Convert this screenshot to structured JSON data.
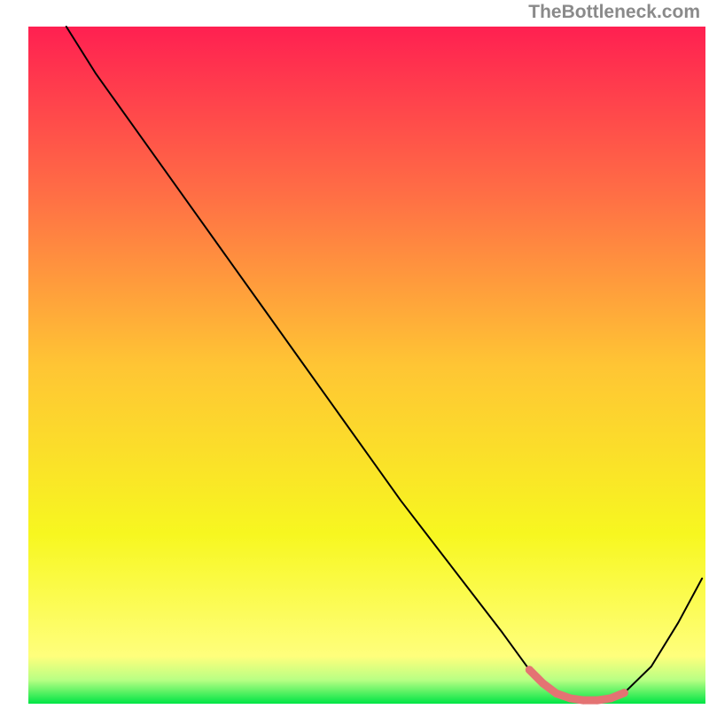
{
  "attribution": "TheBottleneck.com",
  "chart_data": {
    "type": "line",
    "title": "",
    "xlabel": "",
    "ylabel": "",
    "xlim": [
      0,
      100
    ],
    "ylim": [
      0,
      100
    ],
    "background": {
      "type": "vertical-gradient",
      "stops": [
        {
          "offset": 0.0,
          "color": "#ff2051"
        },
        {
          "offset": 0.25,
          "color": "#ff6f45"
        },
        {
          "offset": 0.5,
          "color": "#ffc534"
        },
        {
          "offset": 0.75,
          "color": "#f7f720"
        },
        {
          "offset": 0.93,
          "color": "#ffff7c"
        },
        {
          "offset": 0.965,
          "color": "#b8ff84"
        },
        {
          "offset": 1.0,
          "color": "#00e545"
        }
      ]
    },
    "series": [
      {
        "name": "bottleneck-curve",
        "color": "#000000",
        "width": 2,
        "x": [
          5.6,
          10,
          15,
          20,
          25,
          30,
          35,
          40,
          45,
          50,
          55,
          60,
          65,
          70,
          74,
          76,
          78,
          80,
          82,
          84,
          86,
          88,
          92,
          96,
          99.5
        ],
        "y": [
          100,
          93,
          86,
          79,
          72,
          65,
          58,
          51,
          44,
          37,
          30,
          23.5,
          17,
          10.5,
          5,
          3,
          1.5,
          0.8,
          0.5,
          0.5,
          0.8,
          1.6,
          5.5,
          12,
          18.5
        ]
      },
      {
        "name": "optimal-highlight",
        "color": "#e47373",
        "width": 9,
        "x": [
          74,
          76,
          78,
          80,
          82,
          84,
          86,
          88
        ],
        "y": [
          5,
          3,
          1.5,
          0.8,
          0.5,
          0.5,
          0.8,
          1.6
        ]
      }
    ]
  }
}
